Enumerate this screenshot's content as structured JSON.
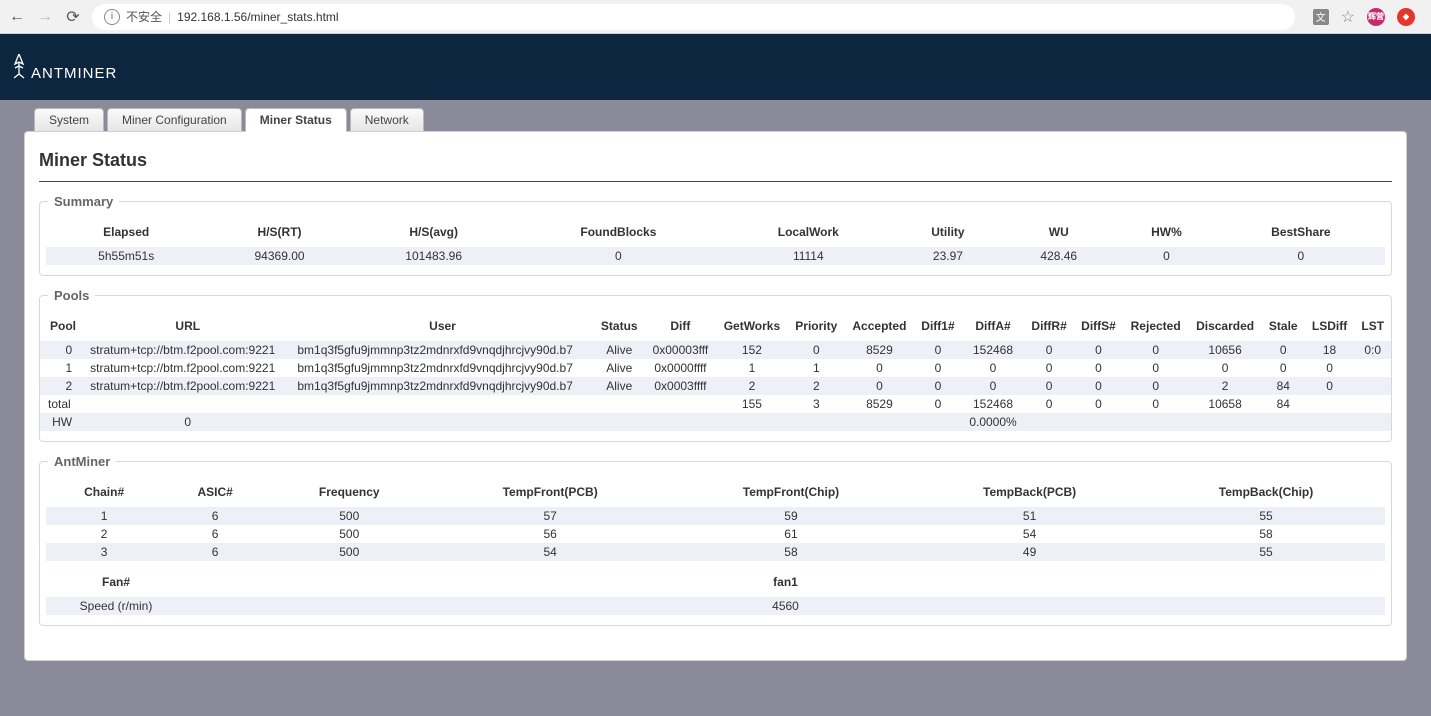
{
  "browser": {
    "insecure_label": "不安全",
    "url": "192.168.1.56/miner_stats.html",
    "avatar1_text": "辉营"
  },
  "logo": {
    "text": "ANTMINER"
  },
  "tabs": {
    "system": "System",
    "miner_config": "Miner Configuration",
    "miner_status": "Miner Status",
    "network": "Network"
  },
  "page_title": "Miner Status",
  "summary": {
    "legend": "Summary",
    "headers": {
      "elapsed": "Elapsed",
      "hsrt": "H/S(RT)",
      "hsavg": "H/S(avg)",
      "found": "FoundBlocks",
      "localwork": "LocalWork",
      "utility": "Utility",
      "wu": "WU",
      "hwp": "HW%",
      "bestshare": "BestShare"
    },
    "values": {
      "elapsed": "5h55m51s",
      "hsrt": "94369.00",
      "hsavg": "101483.96",
      "found": "0",
      "localwork": "11114",
      "utility": "23.97",
      "wu": "428.46",
      "hwp": "0",
      "bestshare": "0"
    }
  },
  "pools": {
    "legend": "Pools",
    "headers": {
      "pool": "Pool",
      "url": "URL",
      "user": "User",
      "status": "Status",
      "diff": "Diff",
      "getworks": "GetWorks",
      "priority": "Priority",
      "accepted": "Accepted",
      "diff1": "Diff1#",
      "diffA": "DiffA#",
      "diffR": "DiffR#",
      "diffS": "DiffS#",
      "rejected": "Rejected",
      "discarded": "Discarded",
      "stale": "Stale",
      "lsdiff": "LSDiff",
      "lst": "LST"
    },
    "rows": [
      {
        "pool": "0",
        "url": "stratum+tcp://btm.f2pool.com:9221",
        "user": "bm1q3f5gfu9jmmnp3tz2mdnrxfd9vnqdjhrcjvy90d.b7",
        "status": "Alive",
        "diff": "0x00003fff",
        "getworks": "152",
        "priority": "0",
        "accepted": "8529",
        "diff1": "0",
        "diffA": "152468",
        "diffR": "0",
        "diffS": "0",
        "rejected": "0",
        "discarded": "10656",
        "stale": "0",
        "lsdiff": "18",
        "lst": "0:0"
      },
      {
        "pool": "1",
        "url": "stratum+tcp://btm.f2pool.com:9221",
        "user": "bm1q3f5gfu9jmmnp3tz2mdnrxfd9vnqdjhrcjvy90d.b7",
        "status": "Alive",
        "diff": "0x0000ffff",
        "getworks": "1",
        "priority": "1",
        "accepted": "0",
        "diff1": "0",
        "diffA": "0",
        "diffR": "0",
        "diffS": "0",
        "rejected": "0",
        "discarded": "0",
        "stale": "0",
        "lsdiff": "0",
        "lst": ""
      },
      {
        "pool": "2",
        "url": "stratum+tcp://btm.f2pool.com:9221",
        "user": "bm1q3f5gfu9jmmnp3tz2mdnrxfd9vnqdjhrcjvy90d.b7",
        "status": "Alive",
        "diff": "0x0003ffff",
        "getworks": "2",
        "priority": "2",
        "accepted": "0",
        "diff1": "0",
        "diffA": "0",
        "diffR": "0",
        "diffS": "0",
        "rejected": "0",
        "discarded": "2",
        "stale": "84",
        "lsdiff": "0",
        "lst": ""
      }
    ],
    "total_label": "total",
    "total": {
      "getworks": "155",
      "priority": "3",
      "accepted": "8529",
      "diff1": "0",
      "diffA": "152468",
      "diffR": "0",
      "diffS": "0",
      "rejected": "0",
      "discarded": "10658",
      "stale": "84"
    },
    "hw_label": "HW",
    "hw_url_col": "0",
    "hw_percent": "0.0000%"
  },
  "antminer": {
    "legend": "AntMiner",
    "headers": {
      "chain": "Chain#",
      "asic": "ASIC#",
      "freq": "Frequency",
      "tfpcb": "TempFront(PCB)",
      "tfchip": "TempFront(Chip)",
      "tbpcb": "TempBack(PCB)",
      "tbchip": "TempBack(Chip)"
    },
    "rows": [
      {
        "chain": "1",
        "asic": "6",
        "freq": "500",
        "tfpcb": "57",
        "tfchip": "59",
        "tbpcb": "51",
        "tbchip": "55"
      },
      {
        "chain": "2",
        "asic": "6",
        "freq": "500",
        "tfpcb": "56",
        "tfchip": "61",
        "tbpcb": "54",
        "tbchip": "58"
      },
      {
        "chain": "3",
        "asic": "6",
        "freq": "500",
        "tfpcb": "54",
        "tfchip": "58",
        "tbpcb": "49",
        "tbchip": "55"
      }
    ],
    "fan_headers": {
      "fan": "Fan#",
      "fan1": "fan1"
    },
    "speed_label": "Speed (r/min)",
    "speed_value": "4560"
  }
}
